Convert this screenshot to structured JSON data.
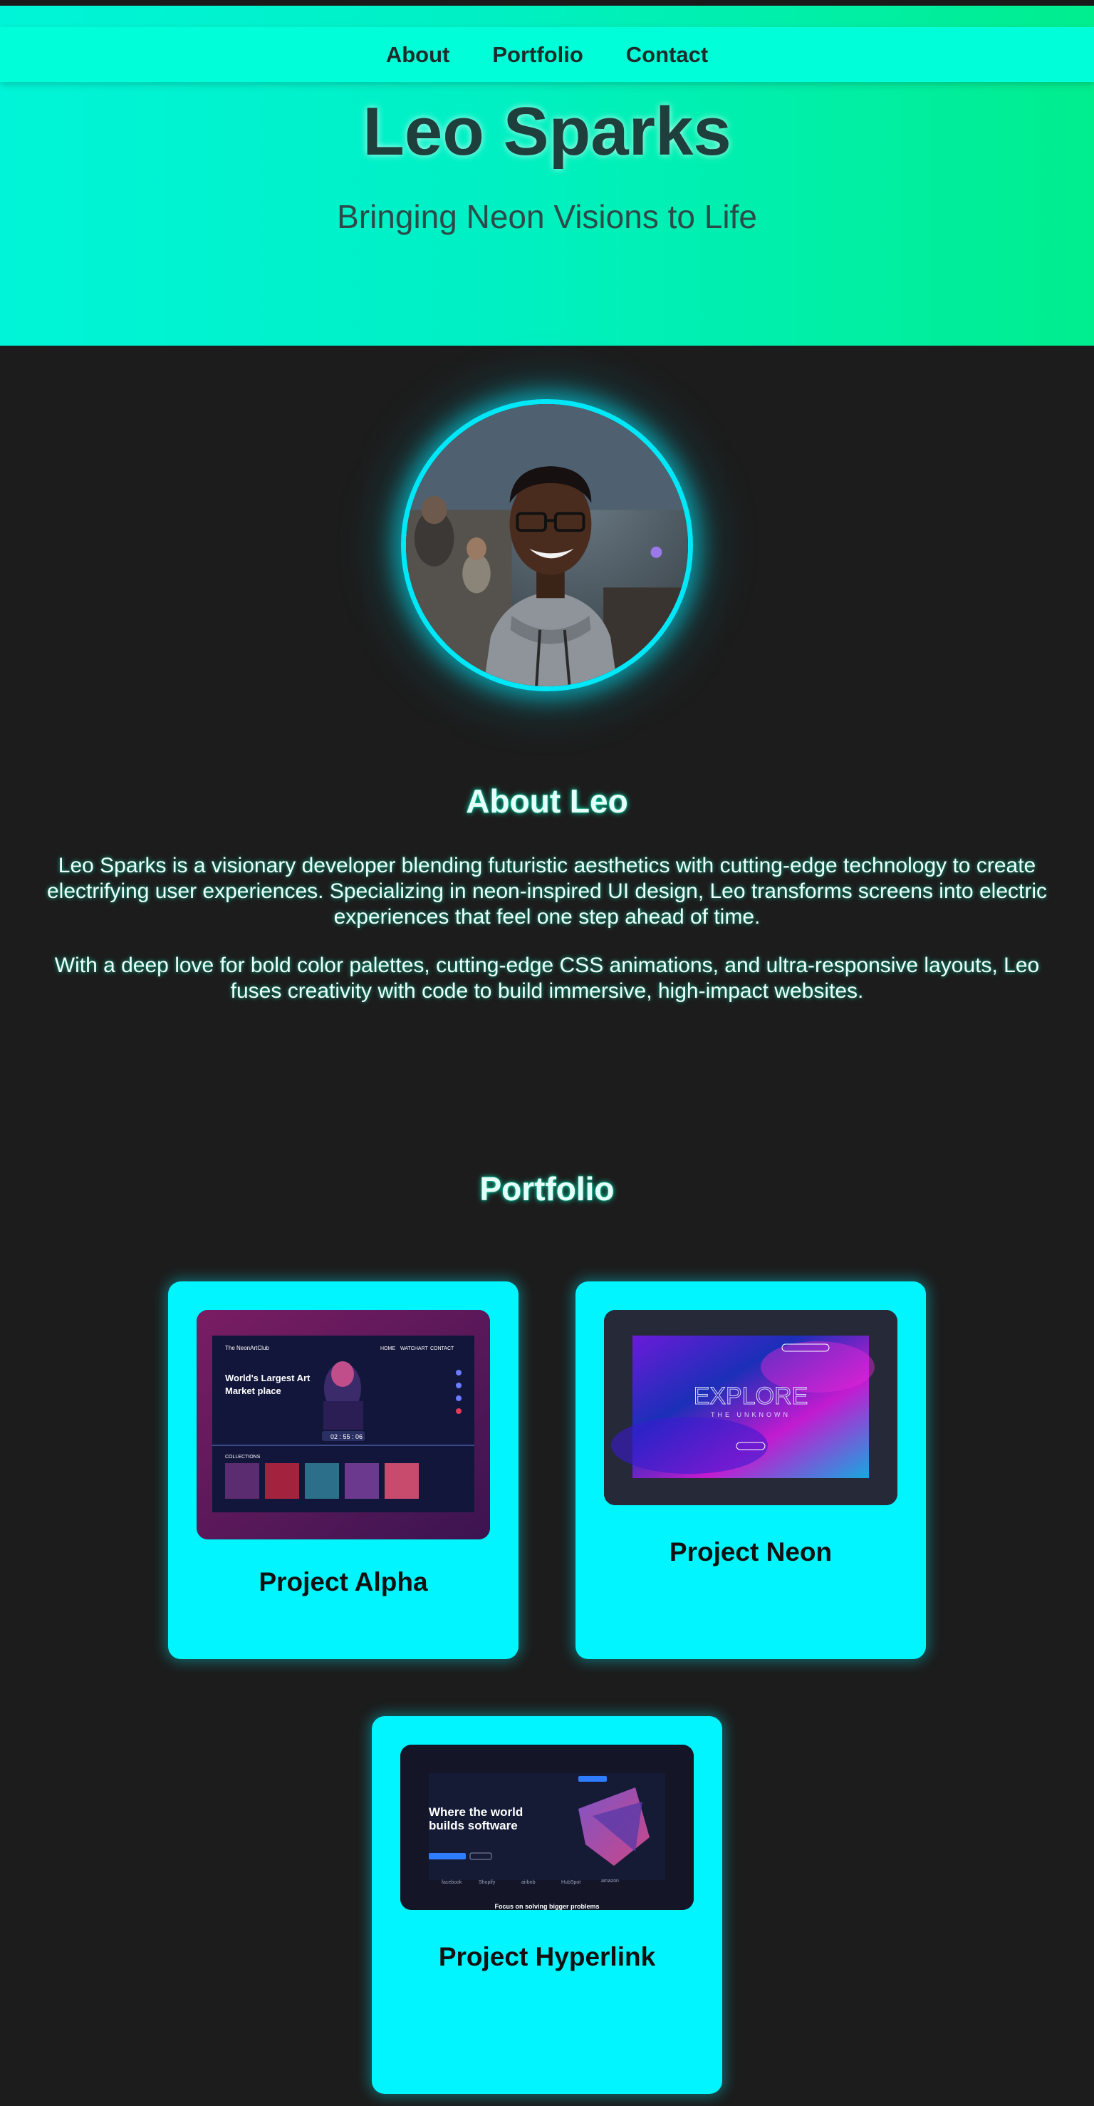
{
  "nav": {
    "items": [
      "About",
      "Portfolio",
      "Contact"
    ]
  },
  "hero": {
    "title": "Leo Sparks",
    "subtitle": "Bringing Neon Visions to Life"
  },
  "about": {
    "title": "About Leo",
    "paragraph1": "Leo Sparks is a visionary developer blending futuristic aesthetics with cutting-edge technology to create electrifying user experiences. Specializing in neon-inspired UI design, Leo transforms screens into electric experiences that feel one step ahead of time.",
    "paragraph2": "With a deep love for bold color palettes, cutting-edge CSS animations, and ultra-responsive layouts, Leo fuses creativity with code to build immersive, high-impact websites."
  },
  "portfolio": {
    "title": "Portfolio",
    "projects": [
      {
        "name": "Project Alpha",
        "preview": {
          "brand": "The NeonArtClub",
          "nav": [
            "HOME",
            "WATCHART",
            "CONTACT"
          ],
          "headline1": "World's Largest Art",
          "headline2": "Market place",
          "timer": "02 : 55 : 06",
          "section": "COLLECTIONS"
        }
      },
      {
        "name": "Project Neon",
        "preview": {
          "headline": "EXPLORE",
          "tagline": "THE UNKNOWN"
        }
      },
      {
        "name": "Project Hyperlink",
        "preview": {
          "headline1": "Where the world",
          "headline2": "builds software",
          "logos": [
            "facebook",
            "Shopify",
            "airbnb",
            "HubSpot",
            "amazon"
          ],
          "footer": "Focus on solving bigger problems"
        }
      }
    ]
  },
  "colors": {
    "accent": "#00f5ff",
    "hero_start": "#00f5d8",
    "hero_end": "#00ee8e",
    "background": "#1c1c1c"
  }
}
